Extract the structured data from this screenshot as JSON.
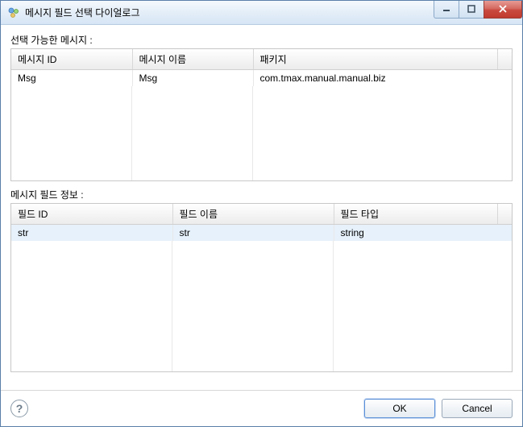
{
  "window": {
    "title": "메시지 필드 선택 다이얼로그"
  },
  "topSection": {
    "label": "선택 가능한 메시지 :",
    "columns": {
      "id": "메시지 ID",
      "name": "메시지 이름",
      "package": "패키지"
    },
    "rows": [
      {
        "id": "Msg",
        "name": "Msg",
        "package": "com.tmax.manual.manual.biz"
      }
    ]
  },
  "bottomSection": {
    "label": "메시지 필드 정보 :",
    "columns": {
      "id": "필드 ID",
      "name": "필드 이름",
      "type": "필드 타입"
    },
    "rows": [
      {
        "id": "str",
        "name": "str",
        "type": "string"
      }
    ]
  },
  "footer": {
    "ok": "OK",
    "cancel": "Cancel"
  }
}
